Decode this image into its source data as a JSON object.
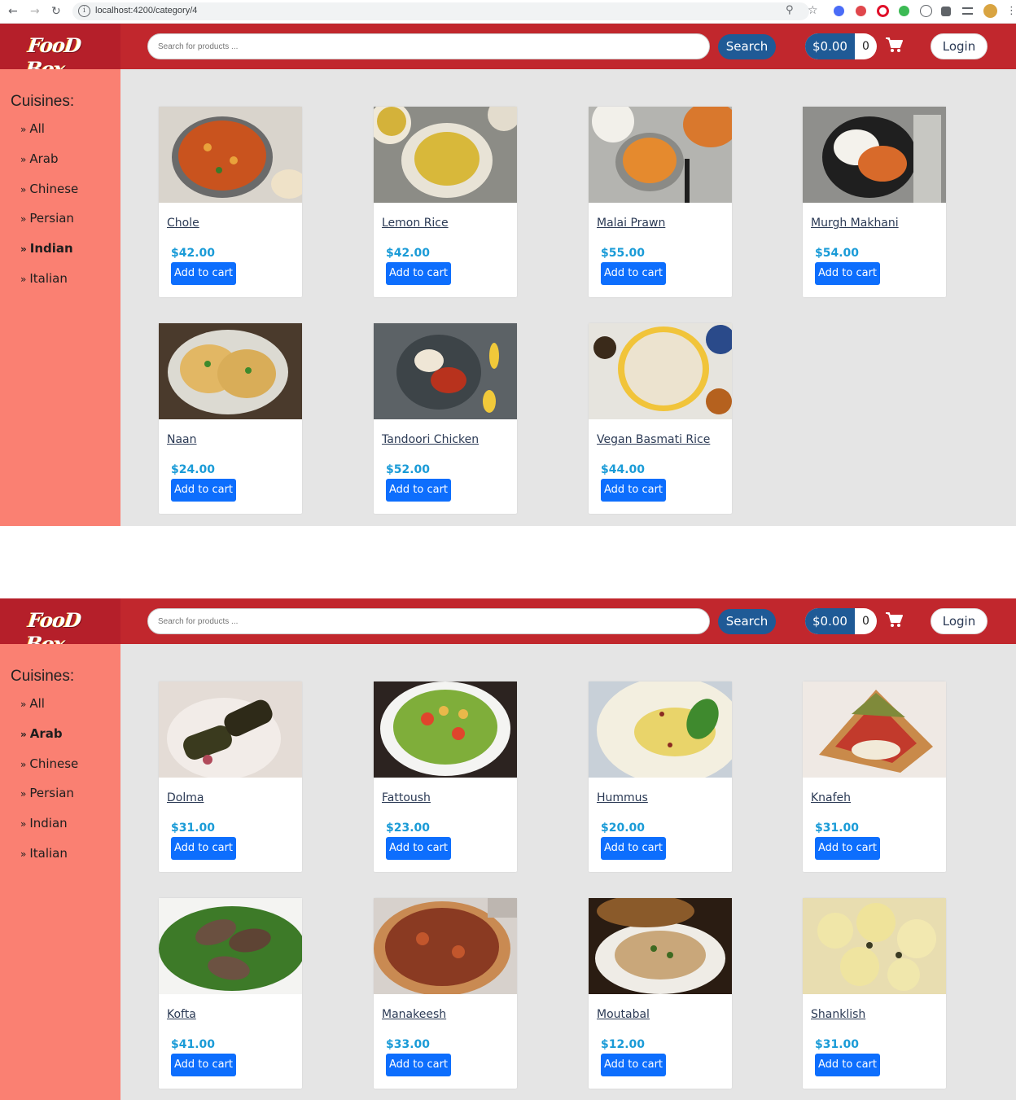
{
  "browser": {
    "url": "localhost:4200/category/4"
  },
  "header": {
    "logo_text": "FooD Box",
    "search_placeholder": "Search for products ...",
    "search_label": "Search",
    "cart_total": "$0.00",
    "cart_count": "0",
    "login_label": "Login"
  },
  "screens": [
    {
      "sidebar": {
        "title": "Cuisines:",
        "items": [
          "All",
          "Arab",
          "Chinese",
          "Persian",
          "Indian",
          "Italian"
        ],
        "active": "Indian"
      },
      "products": [
        {
          "name": "Chole",
          "price": "$42.00",
          "button": "Add to cart"
        },
        {
          "name": "Lemon Rice",
          "price": "$42.00",
          "button": "Add to cart"
        },
        {
          "name": "Malai Prawn",
          "price": "$55.00",
          "button": "Add to cart"
        },
        {
          "name": "Murgh Makhani",
          "price": "$54.00",
          "button": "Add to cart"
        },
        {
          "name": "Naan",
          "price": "$24.00",
          "button": "Add to cart"
        },
        {
          "name": "Tandoori Chicken",
          "price": "$52.00",
          "button": "Add to cart"
        },
        {
          "name": "Vegan Basmati Rice",
          "price": "$44.00",
          "button": "Add to cart"
        }
      ]
    },
    {
      "sidebar": {
        "title": "Cuisines:",
        "items": [
          "All",
          "Arab",
          "Chinese",
          "Persian",
          "Indian",
          "Italian"
        ],
        "active": "Arab"
      },
      "products": [
        {
          "name": "Dolma",
          "price": "$31.00",
          "button": "Add to cart"
        },
        {
          "name": "Fattoush",
          "price": "$23.00",
          "button": "Add to cart"
        },
        {
          "name": "Hummus",
          "price": "$20.00",
          "button": "Add to cart"
        },
        {
          "name": "Knafeh",
          "price": "$31.00",
          "button": "Add to cart"
        },
        {
          "name": "Kofta",
          "price": "$41.00",
          "button": "Add to cart"
        },
        {
          "name": "Manakeesh",
          "price": "$33.00",
          "button": "Add to cart"
        },
        {
          "name": "Moutabal",
          "price": "$12.00",
          "button": "Add to cart"
        },
        {
          "name": "Shanklish",
          "price": "$31.00",
          "button": "Add to cart"
        }
      ]
    }
  ],
  "colors": {
    "header_red": "#c1272d",
    "sidebar_salmon": "#fa8072",
    "content_gray": "#e5e5e5",
    "primary_blue": "#0d6efd",
    "price_blue": "#1a9bd7",
    "dark_blue": "#1f5a96"
  },
  "icons": [
    "back-arrow-icon",
    "forward-arrow-icon",
    "reload-icon",
    "info-icon",
    "zoom-icon",
    "star-icon",
    "cart-icon",
    "menu-dots-icon"
  ]
}
